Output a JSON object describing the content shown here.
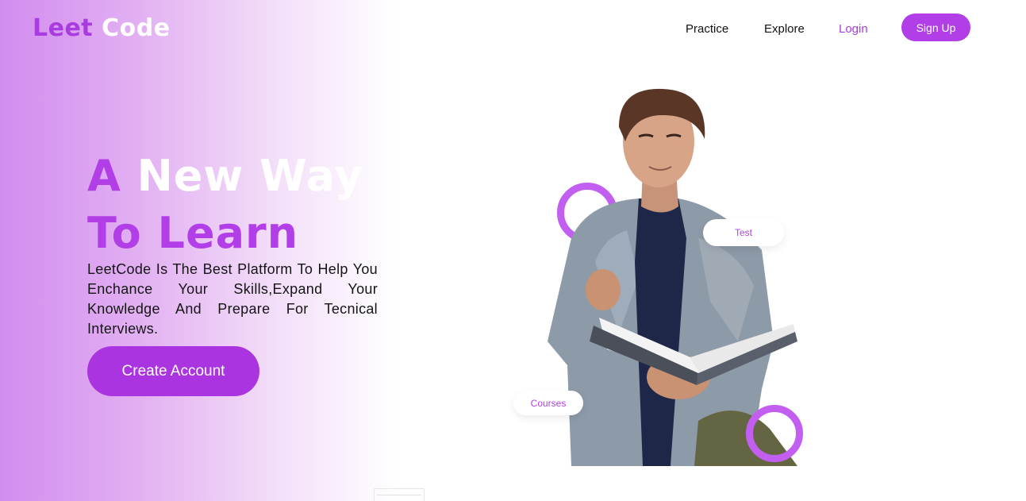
{
  "brand": {
    "leet": "Leet",
    "code": "Code"
  },
  "nav": {
    "practice": "Practice",
    "explore": "Explore",
    "login": "Login",
    "signup": "Sign Up"
  },
  "hero": {
    "headline_a": "A",
    "headline_rest": "New Way",
    "headline_line2": "To Learn",
    "description": "LeetCode Is The Best Platform To Help You Enchance Your Skills,Expand Your Knowledge And Prepare For Tecnical Interviews.",
    "cta": "Create Account"
  },
  "badges": {
    "test": "Test",
    "courses": "Courses"
  },
  "colors": {
    "accent": "#b13ee6",
    "gradient_start": "#d28cf0"
  }
}
